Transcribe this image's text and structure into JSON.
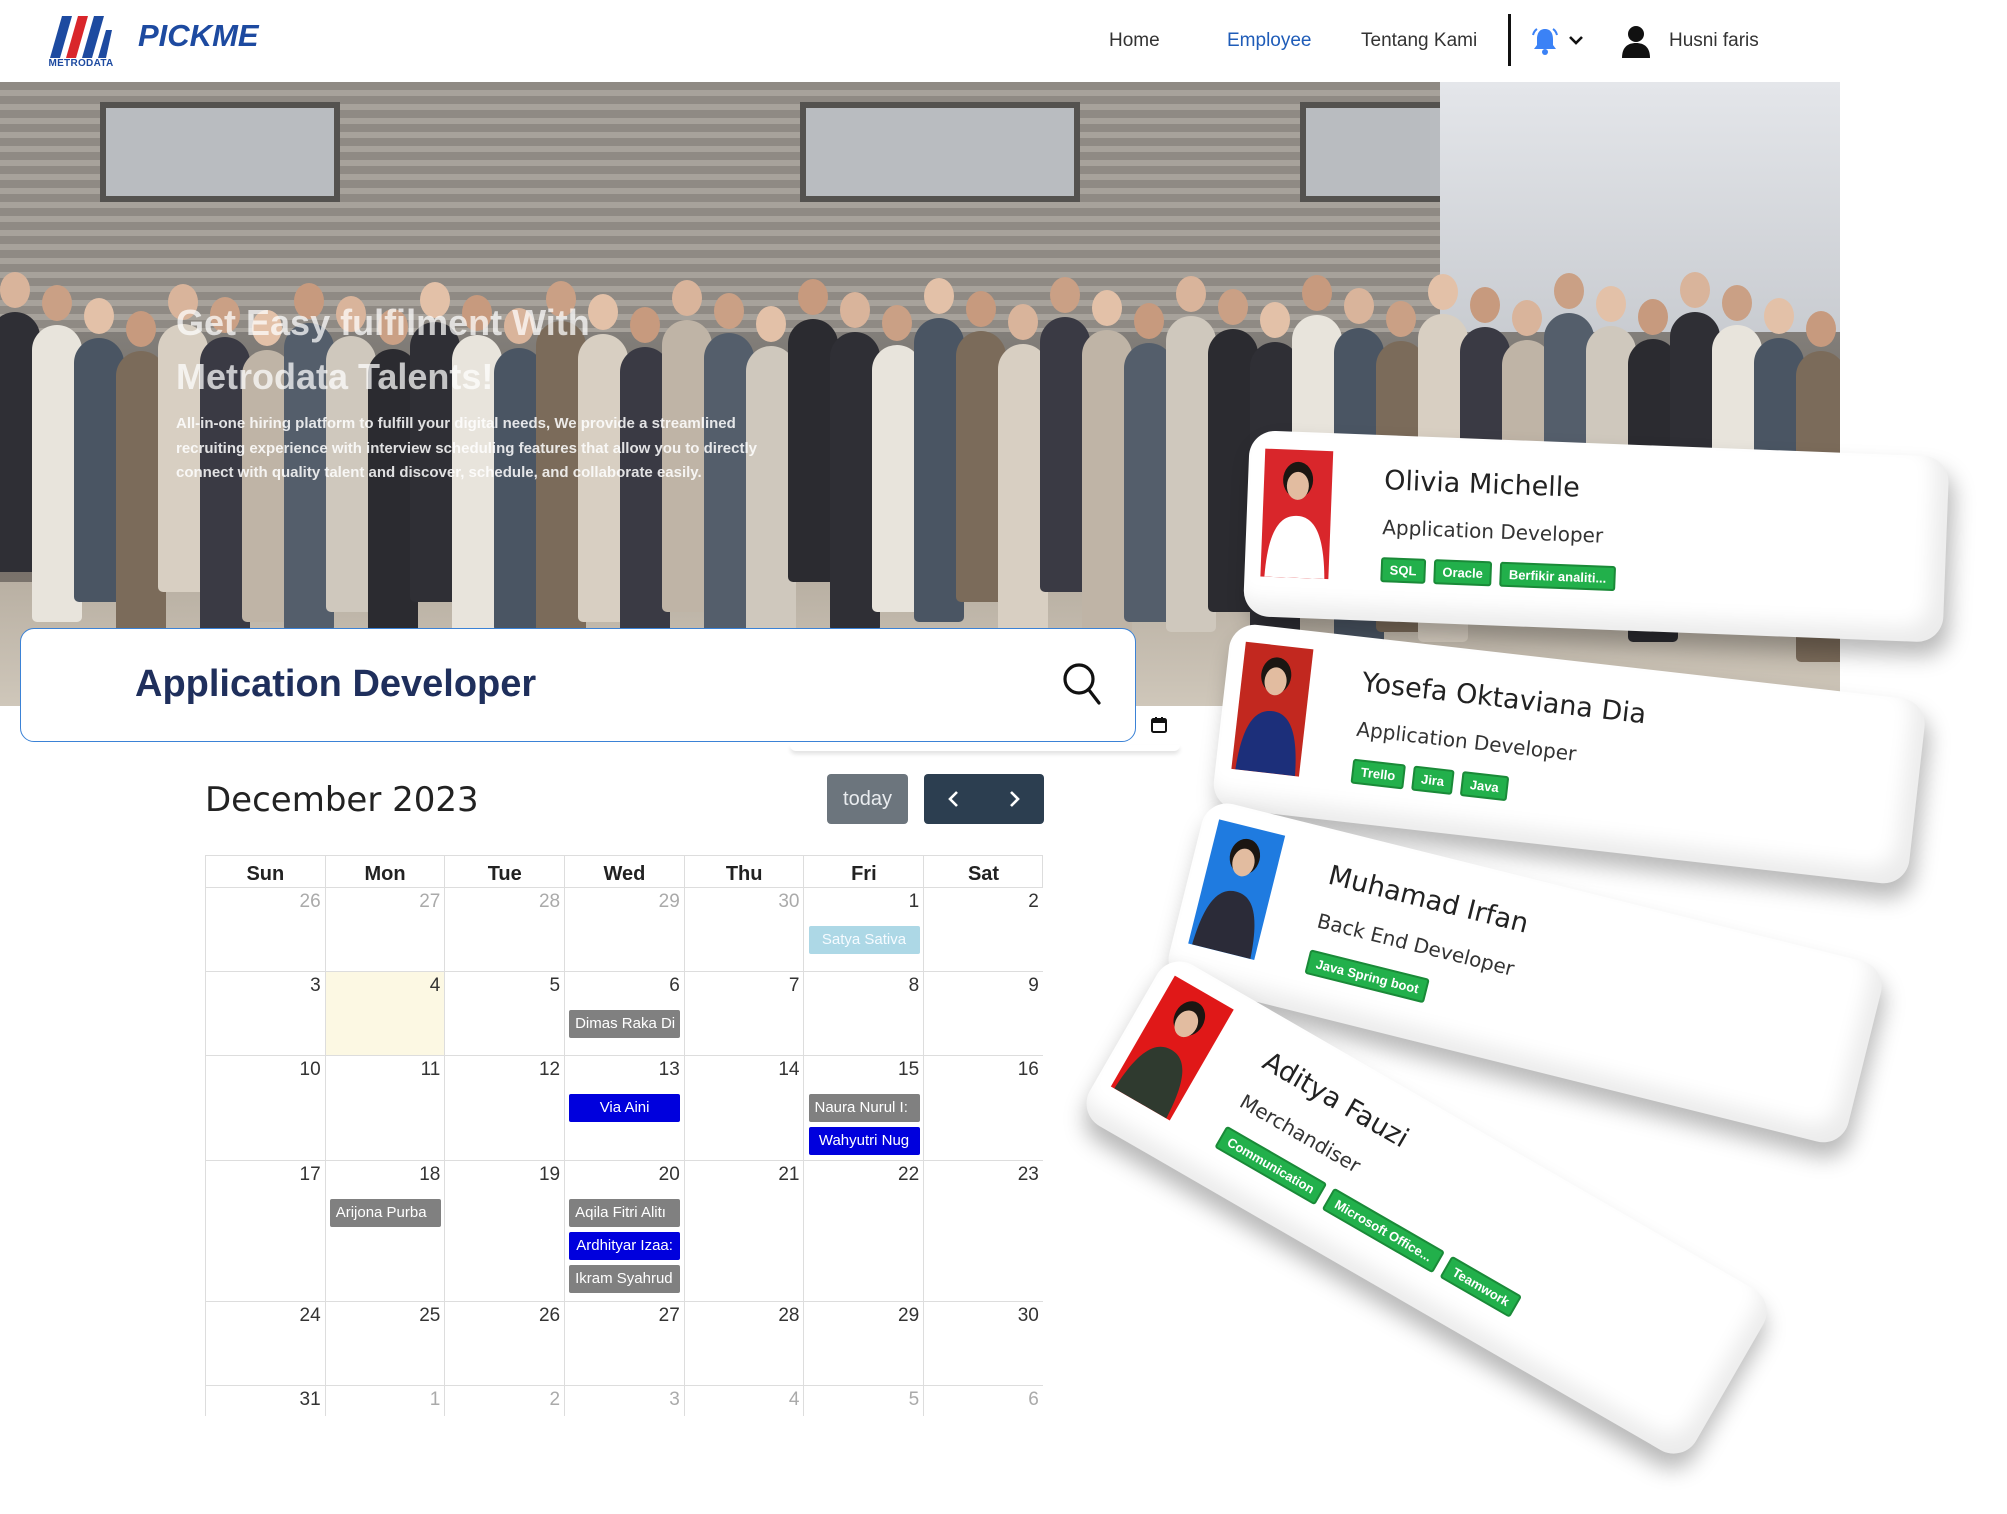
{
  "navbar": {
    "logo_text": "METRODATA",
    "brand": "PICKME",
    "links": [
      "Home",
      "Employee",
      "Tentang Kami"
    ],
    "active_link": "Employee",
    "user_name": "Husni faris",
    "colors": {
      "brand": "#1d4aa0",
      "active_link": "#1f5cb8"
    }
  },
  "hero": {
    "title": "Get Easy fulfilment With Metrodata Talents!",
    "description": "All-in-one hiring platform to fulfill your digital needs, We provide a streamlined recruiting experience with interview scheduling features that allow you to directly connect with quality talent  and discover, schedule, and collaborate easily."
  },
  "search": {
    "value": "Application Developer",
    "icon": "search-icon"
  },
  "calendar": {
    "title": "December 2023",
    "today_label": "today",
    "weekdays": [
      "Sun",
      "Mon",
      "Tue",
      "Wed",
      "Thu",
      "Fri",
      "Sat"
    ],
    "weeks": [
      [
        {
          "d": "26",
          "other": true
        },
        {
          "d": "27",
          "other": true
        },
        {
          "d": "28",
          "other": true
        },
        {
          "d": "29",
          "other": true
        },
        {
          "d": "30",
          "other": true
        },
        {
          "d": "1",
          "events": [
            {
              "label": "Satya Sativa",
              "color": "light"
            }
          ]
        },
        {
          "d": "2"
        }
      ],
      [
        {
          "d": "3"
        },
        {
          "d": "4",
          "today": true
        },
        {
          "d": "5"
        },
        {
          "d": "6",
          "events": [
            {
              "label": "Dimas Raka Di",
              "color": "gray"
            }
          ]
        },
        {
          "d": "7"
        },
        {
          "d": "8"
        },
        {
          "d": "9"
        }
      ],
      [
        {
          "d": "10"
        },
        {
          "d": "11"
        },
        {
          "d": "12"
        },
        {
          "d": "13",
          "events": [
            {
              "label": "Via Aini",
              "color": "blue"
            }
          ]
        },
        {
          "d": "14"
        },
        {
          "d": "15",
          "events": [
            {
              "label": "Naura Nurul I:",
              "color": "gray"
            },
            {
              "label": "Wahyutri Nug",
              "color": "blue"
            }
          ]
        },
        {
          "d": "16"
        }
      ],
      [
        {
          "d": "17"
        },
        {
          "d": "18",
          "events": [
            {
              "label": "Arijona Purba",
              "color": "gray"
            }
          ]
        },
        {
          "d": "19"
        },
        {
          "d": "20",
          "events": [
            {
              "label": "Aqila Fitri Alitı",
              "color": "gray"
            },
            {
              "label": "Ardhityar Izaa:",
              "color": "blue"
            },
            {
              "label": "Ikram Syahrud",
              "color": "gray"
            }
          ]
        },
        {
          "d": "21"
        },
        {
          "d": "22"
        },
        {
          "d": "23"
        }
      ],
      [
        {
          "d": "24"
        },
        {
          "d": "25"
        },
        {
          "d": "26"
        },
        {
          "d": "27"
        },
        {
          "d": "28"
        },
        {
          "d": "29"
        },
        {
          "d": "30"
        }
      ],
      [
        {
          "d": "31"
        },
        {
          "d": "1",
          "other": true
        },
        {
          "d": "2",
          "other": true
        },
        {
          "d": "3",
          "other": true
        },
        {
          "d": "4",
          "other": true
        },
        {
          "d": "5",
          "other": true
        },
        {
          "d": "6",
          "other": true
        }
      ]
    ],
    "event_colors": {
      "gray": "#808080",
      "blue": "#0000dd",
      "light": "#add8e6",
      "today_bg": "#fcf8e3"
    }
  },
  "talents": [
    {
      "name": "Olivia Michelle",
      "role": "Application Developer",
      "skills": [
        "SQL",
        "Oracle",
        "Berfikir analiti..."
      ],
      "photo_bg": "#d9262b",
      "shirt": "#ffffff"
    },
    {
      "name": "Yosefa Oktaviana Dia",
      "role": "Application Developer",
      "skills": [
        "Trello",
        "Jira",
        "Java"
      ],
      "photo_bg": "#c2281f",
      "shirt": "#1c2f7a"
    },
    {
      "name": "Muhamad Irfan",
      "role": "Back End Developer",
      "skills": [
        "Java Spring boot"
      ],
      "photo_bg": "#1f7be0",
      "shirt": "#2b2b38"
    },
    {
      "name": "Aditya Fauzi",
      "role": "Merchandiser",
      "skills": [
        "Communication",
        "Microsoft Office...",
        "Teamwork"
      ],
      "photo_bg": "#e01818",
      "shirt": "#2f3a2f"
    }
  ],
  "skill_tag_color": "#22b04b"
}
